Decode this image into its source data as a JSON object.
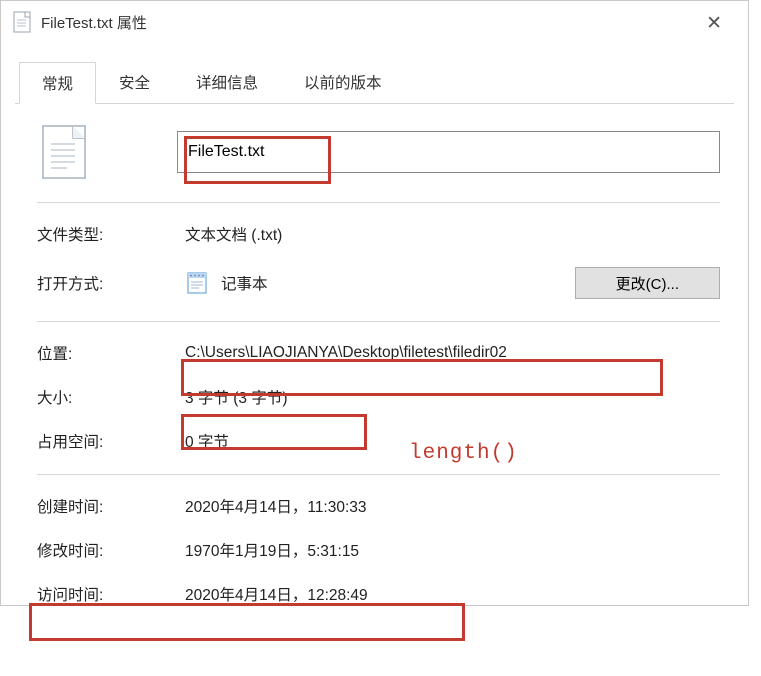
{
  "title": "FileTest.txt 属性",
  "tabs": {
    "general": "常规",
    "security": "安全",
    "details": "详细信息",
    "previous": "以前的版本"
  },
  "filename": "FileTest.txt",
  "labels": {
    "filetype": "文件类型:",
    "openwith": "打开方式:",
    "location": "位置:",
    "size": "大小:",
    "ondisk": "占用空间:",
    "created": "创建时间:",
    "modified": "修改时间:",
    "accessed": "访问时间:"
  },
  "values": {
    "filetype": "文本文档 (.txt)",
    "openwith": "记事本",
    "location": "C:\\Users\\LIAOJIANYA\\Desktop\\filetest\\filedir02",
    "size": "3 字节 (3 字节)",
    "ondisk": "0 字节",
    "created": "2020年4月14日，11:30:33",
    "modified": "1970年1月19日，5:31:15",
    "accessed": "2020年4月14日，12:28:49"
  },
  "buttons": {
    "change": "更改(C)..."
  },
  "annotation": "length()"
}
